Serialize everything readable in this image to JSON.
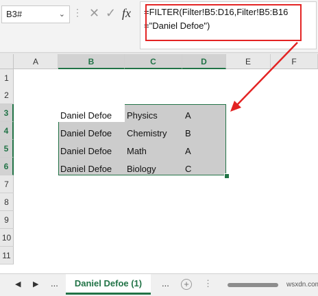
{
  "namebox": {
    "value": "B3#"
  },
  "formula": {
    "line1": "=FILTER(Filter!B5:D16,Filter!B5:B16",
    "line2": "=\"Daniel Defoe\")"
  },
  "columns": [
    "A",
    "B",
    "C",
    "D",
    "E",
    "F"
  ],
  "rows": [
    "1",
    "2",
    "3",
    "4",
    "5",
    "6",
    "7",
    "8",
    "9",
    "10",
    "11"
  ],
  "cells": [
    [
      "Daniel Defoe",
      "Physics",
      "A"
    ],
    [
      "Daniel Defoe",
      "Chemistry",
      "B"
    ],
    [
      "Daniel Defoe",
      "Math",
      "A"
    ],
    [
      "Daniel Defoe",
      "Biology",
      "C"
    ]
  ],
  "sheet_tab": {
    "label": "Daniel Defoe (1)"
  },
  "sheet_nav": {
    "ellipsis_left": "...",
    "ellipsis_right": "..."
  },
  "watermark": "wsxdn.com",
  "colors": {
    "accent": "#217346",
    "callout": "#e32323"
  }
}
